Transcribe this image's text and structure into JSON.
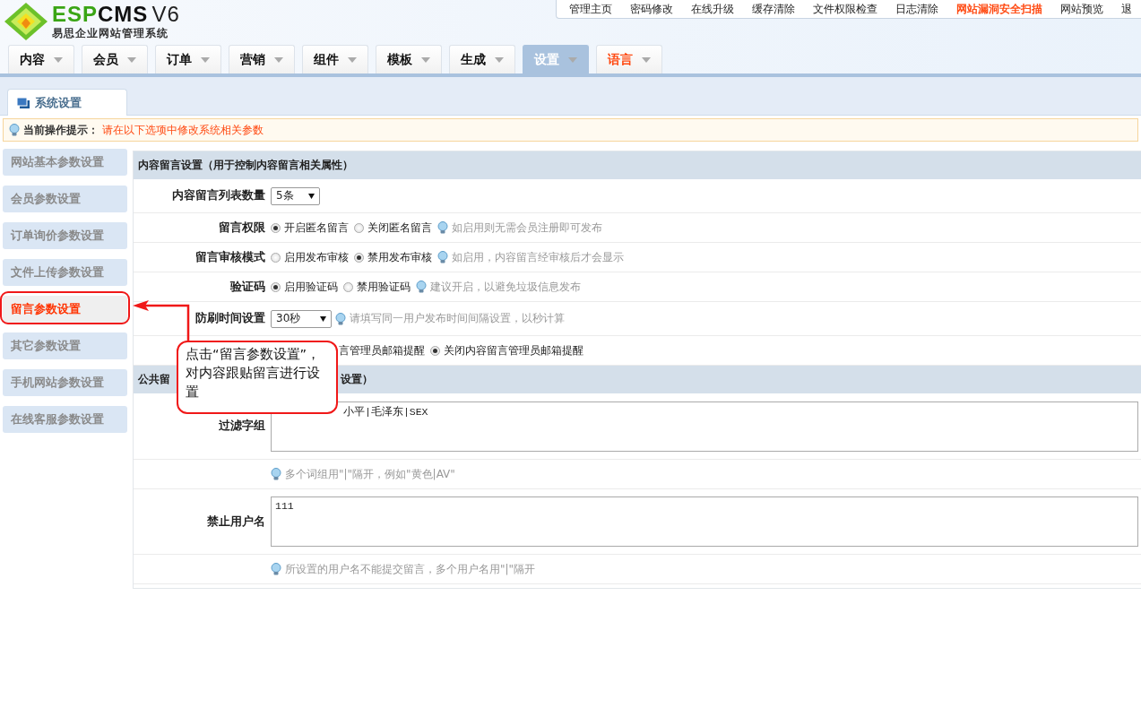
{
  "logo": {
    "brand_a": "ESP",
    "brand_b": "CMS",
    "version": "V6",
    "subtitle": "易思企业网站管理系统"
  },
  "top_links": [
    {
      "label": "管理主页",
      "highlight": false
    },
    {
      "label": "密码修改",
      "highlight": false
    },
    {
      "label": "在线升级",
      "highlight": false
    },
    {
      "label": "缓存清除",
      "highlight": false
    },
    {
      "label": "文件权限检查",
      "highlight": false
    },
    {
      "label": "日志清除",
      "highlight": false
    },
    {
      "label": "网站漏洞安全扫描",
      "highlight": true
    },
    {
      "label": "网站预览",
      "highlight": false
    },
    {
      "label": "退",
      "highlight": false
    }
  ],
  "nav_tabs": [
    {
      "label": "内容",
      "selected": false,
      "highlight": false
    },
    {
      "label": "会员",
      "selected": false,
      "highlight": false
    },
    {
      "label": "订单",
      "selected": false,
      "highlight": false
    },
    {
      "label": "营销",
      "selected": false,
      "highlight": false
    },
    {
      "label": "组件",
      "selected": false,
      "highlight": false
    },
    {
      "label": "模板",
      "selected": false,
      "highlight": false
    },
    {
      "label": "生成",
      "selected": false,
      "highlight": false
    },
    {
      "label": "设置",
      "selected": true,
      "highlight": false
    },
    {
      "label": "语言",
      "selected": false,
      "highlight": true
    }
  ],
  "page_tab": {
    "label": "系统设置"
  },
  "tip": {
    "label": "当前操作提示：",
    "text": "请在以下选项中修改系统相关参数"
  },
  "sidebar": {
    "items": [
      {
        "label": "网站基本参数设置",
        "selected": false
      },
      {
        "label": "会员参数设置",
        "selected": false
      },
      {
        "label": "订单询价参数设置",
        "selected": false
      },
      {
        "label": "文件上传参数设置",
        "selected": false
      },
      {
        "label": "留言参数设置",
        "selected": true
      },
      {
        "label": "其它参数设置",
        "selected": false
      },
      {
        "label": "手机网站参数设置",
        "selected": false
      },
      {
        "label": "在线客服参数设置",
        "selected": false
      }
    ]
  },
  "sections": [
    {
      "title_parts": [
        "内容留言设置（用于控制内容留言相关属性）"
      ],
      "rows": [
        {
          "kind": "select",
          "label": "内容留言列表数量",
          "value": "5条"
        },
        {
          "kind": "radio",
          "label": "留言权限",
          "options": [
            {
              "label": "开启匿名留言",
              "selected": true
            },
            {
              "label": "关闭匿名留言",
              "selected": false
            }
          ],
          "hint": "如启用则无需会员注册即可发布"
        },
        {
          "kind": "radio",
          "label": "留言审核模式",
          "options": [
            {
              "label": "启用发布审核",
              "selected": false
            },
            {
              "label": "禁用发布审核",
              "selected": true
            }
          ],
          "hint": "如启用，内容留言经审核后才会显示"
        },
        {
          "kind": "radio",
          "label": "验证码",
          "options": [
            {
              "label": "启用验证码",
              "selected": true
            },
            {
              "label": "禁用验证码",
              "selected": false
            }
          ],
          "hint": "建议开启，以避免垃圾信息发布"
        },
        {
          "kind": "select",
          "label": "防刷时间设置",
          "value": "30秒",
          "hint": "请填写同一用户发布时间间隔设置，以秒计算"
        },
        {
          "kind": "partial",
          "options": [
            {
              "label": "言管理员邮箱提醒"
            },
            {
              "label": "关闭内容留言管理员邮箱提醒",
              "selected": true
            }
          ]
        }
      ]
    },
    {
      "title_parts": [
        "公共留",
        "设置）"
      ],
      "rows": [
        {
          "kind": "textarea_partial",
          "label": "过滤字组",
          "value": "小平|毛泽东|SEX"
        },
        {
          "kind": "hint",
          "hint": "多个词组用\"|\"隔开，例如\"黄色|AV\""
        },
        {
          "kind": "textarea",
          "label": "禁止用户名",
          "value": "111"
        },
        {
          "kind": "hint",
          "hint": "所设置的用户名不能提交留言，多个用户名用\"|\"隔开"
        }
      ]
    }
  ],
  "callout": {
    "text": "点击“留言参数设置”，对内容跟贴留言进行设置"
  }
}
